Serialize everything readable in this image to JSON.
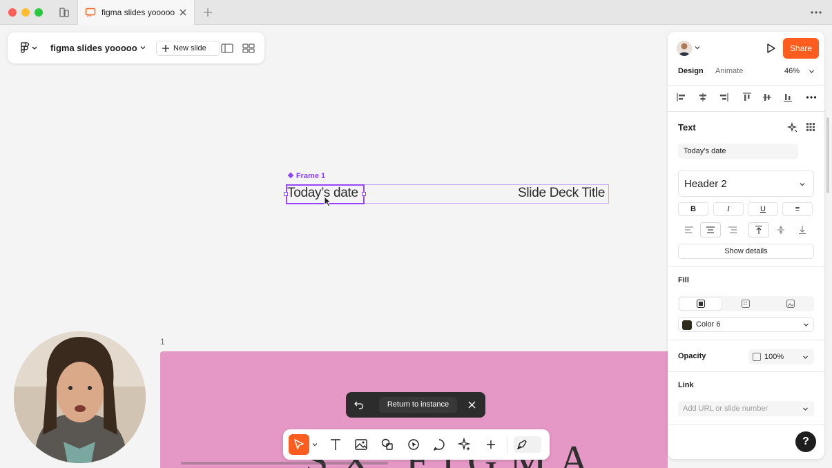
{
  "window": {
    "tab_title": "figma slides yooooo",
    "icons": [
      "sidebar-toggle-icon",
      "slides-file-icon",
      "close-icon",
      "plus-icon",
      "more-icon"
    ]
  },
  "toolbar": {
    "file_name": "figma slides yooooo",
    "new_slide_label": "New slide"
  },
  "canvas": {
    "frame_label": "Frame 1",
    "date_text": "Today’s date",
    "title_text": "Slide Deck Title",
    "slide_number": "1",
    "slide_big_text": "SX FIGMA",
    "slide_color": "#e597c6"
  },
  "instance_bar": {
    "return_label": "Return to instance"
  },
  "bottom_tools": [
    "move-tool",
    "text-tool",
    "image-tool",
    "shape-tool",
    "interaction-tool",
    "comment-tool",
    "ai-tool",
    "plus-tool",
    "draw-tool"
  ],
  "panel": {
    "share_label": "Share",
    "tabs": [
      "Design",
      "Animate"
    ],
    "zoom": "46%",
    "text_section": {
      "title": "Text",
      "layer_name": "Today’s date",
      "text_style": "Header 2",
      "format_buttons": [
        "B",
        "I",
        "U",
        "≡"
      ],
      "show_details_label": "Show details"
    },
    "fill_section": {
      "title": "Fill",
      "color_name": "Color 6",
      "color_hex": "#2e2a1c"
    },
    "opacity_section": {
      "title": "Opacity",
      "value": "100%"
    },
    "link_section": {
      "title": "Link",
      "placeholder": "Add URL or slide number"
    },
    "help_label": "?"
  },
  "colors": {
    "accent": "#ff5d1f",
    "selection": "#9747ff"
  }
}
